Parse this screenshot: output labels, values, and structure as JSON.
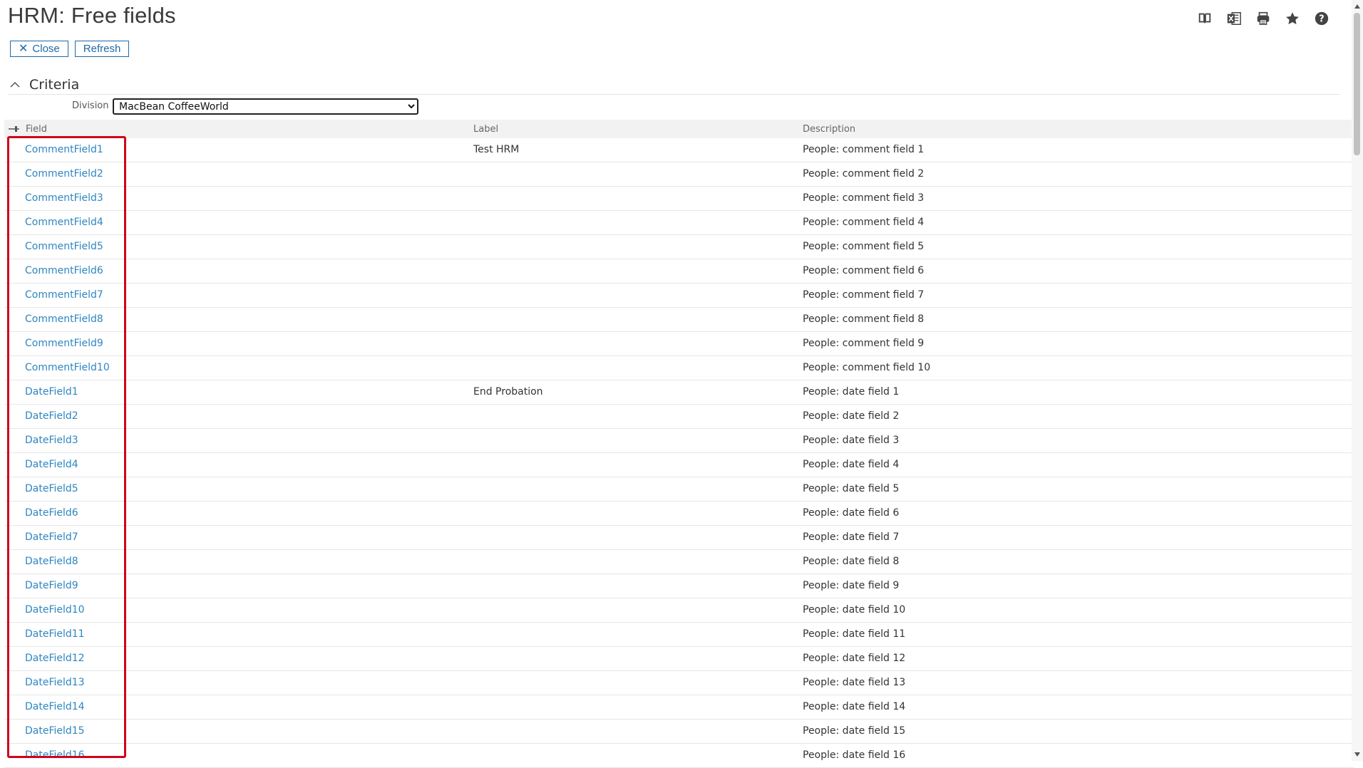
{
  "header": {
    "title": "HRM: Free fields",
    "icons": [
      "book-icon",
      "excel-icon",
      "print-icon",
      "star-icon",
      "help-icon"
    ]
  },
  "buttons": {
    "close_label": "Close",
    "refresh_label": "Refresh"
  },
  "criteria": {
    "title": "Criteria",
    "division_label": "Division",
    "division_value": "MacBean CoffeeWorld"
  },
  "grid": {
    "columns": {
      "field": "Field",
      "label": "Label",
      "description": "Description"
    },
    "rows": [
      {
        "field": "CommentField1",
        "label": "Test HRM",
        "description": "People: comment field 1"
      },
      {
        "field": "CommentField2",
        "label": "",
        "description": "People: comment field 2"
      },
      {
        "field": "CommentField3",
        "label": "",
        "description": "People: comment field 3"
      },
      {
        "field": "CommentField4",
        "label": "",
        "description": "People: comment field 4"
      },
      {
        "field": "CommentField5",
        "label": "",
        "description": "People: comment field 5"
      },
      {
        "field": "CommentField6",
        "label": "",
        "description": "People: comment field 6"
      },
      {
        "field": "CommentField7",
        "label": "",
        "description": "People: comment field 7"
      },
      {
        "field": "CommentField8",
        "label": "",
        "description": "People: comment field 8"
      },
      {
        "field": "CommentField9",
        "label": "",
        "description": "People: comment field 9"
      },
      {
        "field": "CommentField10",
        "label": "",
        "description": "People: comment field 10"
      },
      {
        "field": "DateField1",
        "label": "End Probation",
        "description": "People: date field 1"
      },
      {
        "field": "DateField2",
        "label": "",
        "description": "People: date field 2"
      },
      {
        "field": "DateField3",
        "label": "",
        "description": "People: date field 3"
      },
      {
        "field": "DateField4",
        "label": "",
        "description": "People: date field 4"
      },
      {
        "field": "DateField5",
        "label": "",
        "description": "People: date field 5"
      },
      {
        "field": "DateField6",
        "label": "",
        "description": "People: date field 6"
      },
      {
        "field": "DateField7",
        "label": "",
        "description": "People: date field 7"
      },
      {
        "field": "DateField8",
        "label": "",
        "description": "People: date field 8"
      },
      {
        "field": "DateField9",
        "label": "",
        "description": "People: date field 9"
      },
      {
        "field": "DateField10",
        "label": "",
        "description": "People: date field 10"
      },
      {
        "field": "DateField11",
        "label": "",
        "description": "People: date field 11"
      },
      {
        "field": "DateField12",
        "label": "",
        "description": "People: date field 12"
      },
      {
        "field": "DateField13",
        "label": "",
        "description": "People: date field 13"
      },
      {
        "field": "DateField14",
        "label": "",
        "description": "People: date field 14"
      },
      {
        "field": "DateField15",
        "label": "",
        "description": "People: date field 15"
      },
      {
        "field": "DateField16",
        "label": "",
        "description": "People: date field 16"
      }
    ]
  },
  "colors": {
    "link": "#2e86c1",
    "button_border": "#1f6aa5",
    "highlight": "#d0021b"
  }
}
